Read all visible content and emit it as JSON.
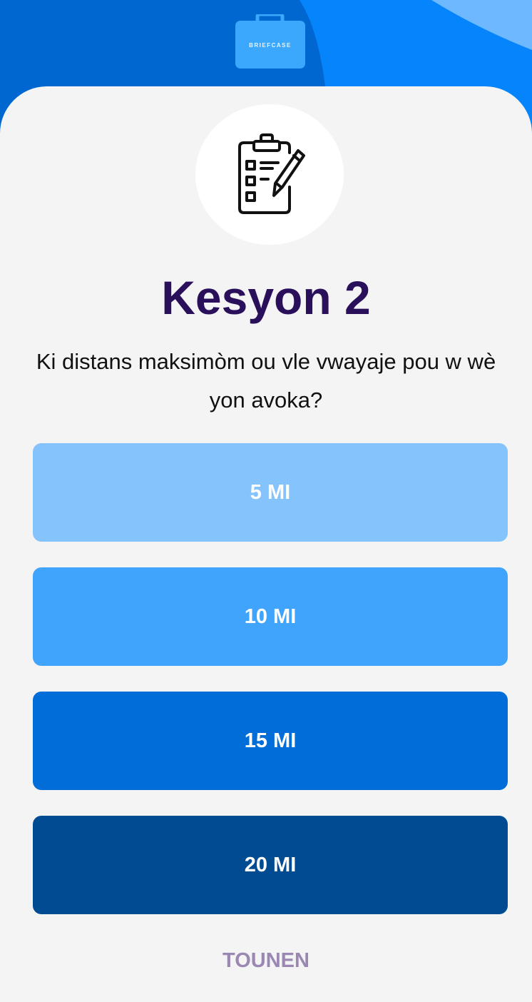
{
  "header": {
    "logo_text": "BRIEFCASE",
    "colors": {
      "dark_blue": "#0067d0",
      "mid_blue": "#0684fb",
      "light_blue": "#6db8ff",
      "logo_blue": "#3ba7fd"
    }
  },
  "quiz": {
    "icon": "clipboard-checklist-icon",
    "title": "Kesyon 2",
    "question": "Ki distans maksimòm ou vle vwayaje pou w wè yon avoka?",
    "answers": [
      {
        "label": "5 MI",
        "color": "#85c3fd"
      },
      {
        "label": "10 MI",
        "color": "#40a4fd"
      },
      {
        "label": "15 MI",
        "color": "#006dd8"
      },
      {
        "label": "20 MI",
        "color": "#004b91"
      }
    ],
    "back_label": "TOUNEN"
  }
}
